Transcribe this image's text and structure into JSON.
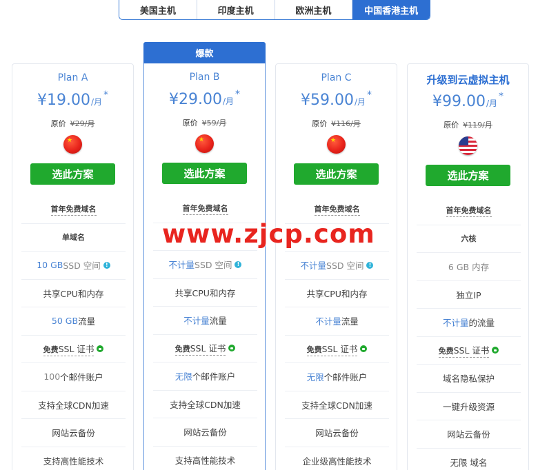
{
  "tabs": [
    "美国主机",
    "印度主机",
    "欧洲主机",
    "中国香港主机"
  ],
  "hot_label": "爆款",
  "watermark": "www.zjcp.com",
  "cards": [
    {
      "name": "Plan A",
      "currency": "¥",
      "price": "19.00",
      "unit": "/月",
      "star": "*",
      "orig_label": "原价",
      "orig_price": "¥29/月",
      "flag": "china-flag",
      "button": "选此方案",
      "features": [
        {
          "a": "首年免费域名",
          "b": "",
          "c": ""
        },
        {
          "a": "单域名",
          "b": "",
          "c": ""
        },
        {
          "a": "10 GB",
          "b": " SSD 空间",
          "c": ""
        },
        {
          "a": "共享CPU和内存",
          "b": "",
          "c": ""
        },
        {
          "a": "50 GB",
          "b": " 流量",
          "c": ""
        },
        {
          "a": "免费",
          "b": "SSL 证书",
          "c": ""
        },
        {
          "a": "100",
          "b": " 个邮件账户",
          "c": ""
        },
        {
          "a": "支持全球CDN加速",
          "b": "",
          "c": ""
        },
        {
          "a": "网站云备份",
          "b": "",
          "c": ""
        },
        {
          "a": "支持高性能技术",
          "b": "",
          "c": ""
        }
      ]
    },
    {
      "name": "Plan B",
      "currency": "¥",
      "price": "29.00",
      "unit": "/月",
      "star": "*",
      "orig_label": "原价",
      "orig_price": "¥59/月",
      "flag": "china-flag",
      "button": "选此方案",
      "features": [
        {
          "a": "首年免费域名",
          "b": "",
          "c": ""
        },
        {
          "a": "",
          "b": "",
          "c": ""
        },
        {
          "a": "不计量",
          "b": " SSD 空间",
          "c": ""
        },
        {
          "a": "共享CPU和内存",
          "b": "",
          "c": ""
        },
        {
          "a": "不计量",
          "b": " 流量",
          "c": ""
        },
        {
          "a": "免费",
          "b": "SSL 证书",
          "c": ""
        },
        {
          "a": "无限",
          "b": " 个邮件账户",
          "c": ""
        },
        {
          "a": "支持全球CDN加速",
          "b": "",
          "c": ""
        },
        {
          "a": "网站云备份",
          "b": "",
          "c": ""
        },
        {
          "a": "支持高性能技术",
          "b": "",
          "c": ""
        }
      ]
    },
    {
      "name": "Plan C",
      "currency": "¥",
      "price": "59.00",
      "unit": "/月",
      "star": "*",
      "orig_label": "原价",
      "orig_price": "¥116/月",
      "flag": "china-flag",
      "button": "选此方案",
      "features": [
        {
          "a": "首年免费域名",
          "b": "",
          "c": ""
        },
        {
          "a": "",
          "b": "",
          "c": ""
        },
        {
          "a": "不计量",
          "b": " SSD 空间",
          "c": ""
        },
        {
          "a": "共享CPU和内存",
          "b": "",
          "c": ""
        },
        {
          "a": "不计量",
          "b": " 流量",
          "c": ""
        },
        {
          "a": "免费",
          "b": "SSL 证书",
          "c": ""
        },
        {
          "a": "无限",
          "b": " 个邮件账户",
          "c": ""
        },
        {
          "a": "支持全球CDN加速",
          "b": "",
          "c": ""
        },
        {
          "a": "网站云备份",
          "b": "",
          "c": ""
        },
        {
          "a": "企业级高性能技术",
          "b": "",
          "c": ""
        }
      ]
    },
    {
      "name": "升级到云虚拟主机",
      "currency": "¥",
      "price": "99.00",
      "unit": "/月",
      "star": "*",
      "orig_label": "原价",
      "orig_price": "¥119/月",
      "flag": "usa-flag",
      "button": "选此方案",
      "features": [
        {
          "a": "首年免费域名",
          "b": "",
          "c": ""
        },
        {
          "a": "六核",
          "b": "",
          "c": ""
        },
        {
          "a": "6 GB 内存",
          "b": "",
          "c": ""
        },
        {
          "a": "独立IP",
          "b": "",
          "c": ""
        },
        {
          "a": "不计量",
          "b": " 的流量",
          "c": ""
        },
        {
          "a": "免费",
          "b": "SSL 证书",
          "c": ""
        },
        {
          "a": "域名隐私保护",
          "b": "",
          "c": ""
        },
        {
          "a": "一键升级资源",
          "b": "",
          "c": ""
        },
        {
          "a": "网站云备份",
          "b": "",
          "c": ""
        },
        {
          "a": "无限 域名",
          "b": "",
          "c": ""
        }
      ]
    }
  ],
  "colors": {
    "accent": "#2d6fd2",
    "button": "#20a92e",
    "price": "#4a84d4"
  }
}
